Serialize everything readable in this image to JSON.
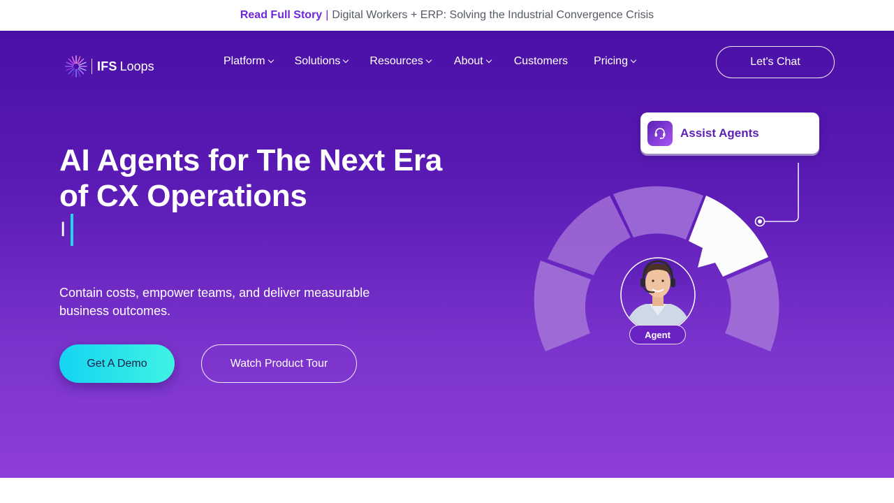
{
  "announcement": {
    "link_label": "Read Full Story",
    "separator": "|",
    "text": "Digital Workers + ERP: Solving the Industrial Convergence Crisis"
  },
  "brand": {
    "name_bold": "IFS",
    "name_light": "Loops",
    "icon": "spiral-logo-icon"
  },
  "nav": {
    "items": [
      {
        "label": "Platform",
        "has_dropdown": true
      },
      {
        "label": "Solutions",
        "has_dropdown": true
      },
      {
        "label": "Resources",
        "has_dropdown": true
      },
      {
        "label": "About",
        "has_dropdown": true
      },
      {
        "label": "Customers",
        "has_dropdown": false
      },
      {
        "label": "Pricing",
        "has_dropdown": true
      }
    ],
    "cta_label": "Let's Chat"
  },
  "hero": {
    "headline_line1": "AI Agents for The Next Era",
    "headline_line2": "of CX Operations",
    "typing_text": "I",
    "subtext": "Contain costs, empower teams, and deliver measurable business outcomes.",
    "primary_cta": "Get A Demo",
    "secondary_cta": "Watch Product Tour"
  },
  "illustration": {
    "card_label": "Assist Agents",
    "card_icon": "headset-icon",
    "agent_label": "Agent",
    "avatar_icon": "agent-avatar"
  },
  "colors": {
    "brand_purple": "#6d28d9",
    "hero_top": "#4a10a6",
    "hero_bottom": "#8e3fd8",
    "cta_gradient_start": "#15d4f2",
    "cta_gradient_end": "#3ff3e2",
    "caret": "#22d3ee"
  }
}
